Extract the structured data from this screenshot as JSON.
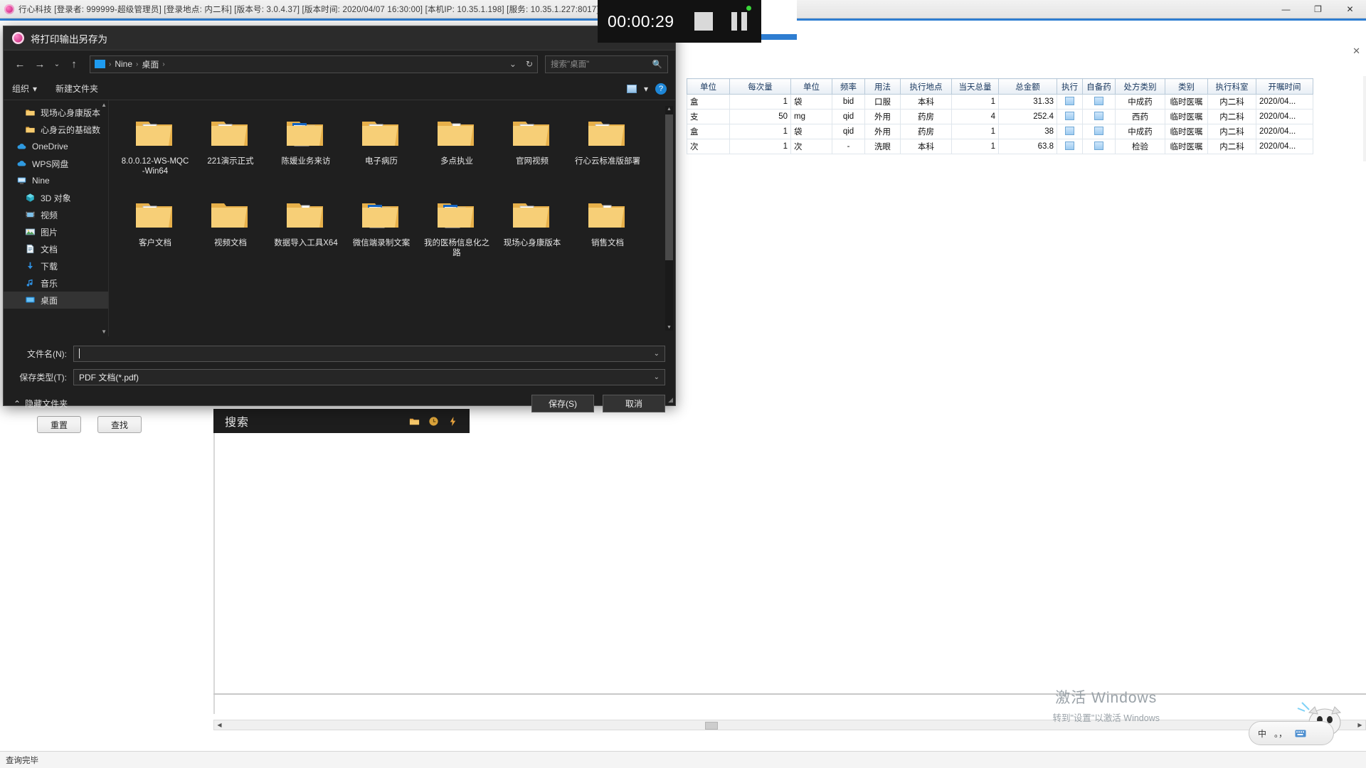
{
  "app": {
    "title": "行心科技   [登录者: 999999-超级管理员]   [登录地点: 内二科]   [版本号: 3.0.4.37]   [版本时间: 2020/04/07 16:30:00]   [本机IP: 10.35.1.198]   [服务: 10.35.1.227:8017]",
    "logo_icon": "app-logo-icon",
    "window_buttons": [
      {
        "name": "minimize",
        "glyph": "—"
      },
      {
        "name": "maximize",
        "glyph": "❐"
      },
      {
        "name": "close",
        "glyph": "✕"
      }
    ],
    "inner_close_glyph": "✕",
    "status_text": "查询完毕",
    "buttons": {
      "reset": "重置",
      "find": "查找"
    },
    "search_window": {
      "title": "搜索",
      "icons": [
        "folder-icon",
        "clock-icon",
        "lightning-icon"
      ]
    },
    "watermark": {
      "line1": "激活 Windows",
      "line2": "转到\"设置\"以激活 Windows"
    },
    "ime": {
      "mode": "中",
      "punctuation": "。，",
      "keyboard_icon": "keyboard-icon",
      "mascot_icon": "mascot-icon"
    }
  },
  "recorder": {
    "timer": "00:00:29",
    "stop_label": "stop-icon",
    "pause_label": "pause-icon",
    "status_dot_color": "#39d639"
  },
  "grid": {
    "columns": [
      "单位",
      "每次量",
      "单位",
      "频率",
      "用法",
      "执行地点",
      "当天总量",
      "总金额",
      "执行",
      "自备药",
      "处方类别",
      "类别",
      "执行科室",
      "开嘱时间"
    ],
    "rows": [
      {
        "unit1": "盒",
        "dose": "1",
        "unit2": "袋",
        "freq": "bid",
        "usage": "口服",
        "place": "本科",
        "day_total": "1",
        "amount": "31.33",
        "exec": "icon",
        "self": "icon",
        "rx_type": "中成药",
        "category": "临时医嘱",
        "dept": "内二科",
        "time": "2020/04..."
      },
      {
        "unit1": "支",
        "dose": "50",
        "unit2": "mg",
        "freq": "qid",
        "usage": "外用",
        "place": "药房",
        "day_total": "4",
        "amount": "252.4",
        "exec": "icon",
        "self": "icon",
        "rx_type": "西药",
        "category": "临时医嘱",
        "dept": "内二科",
        "time": "2020/04..."
      },
      {
        "unit1": "盒",
        "dose": "1",
        "unit2": "袋",
        "freq": "qid",
        "usage": "外用",
        "place": "药房",
        "day_total": "1",
        "amount": "38",
        "exec": "icon",
        "self": "icon",
        "rx_type": "中成药",
        "category": "临时医嘱",
        "dept": "内二科",
        "time": "2020/04..."
      },
      {
        "unit1": "次",
        "dose": "1",
        "unit2": "次",
        "freq": "-",
        "usage": "洗眼",
        "place": "本科",
        "day_total": "1",
        "amount": "63.8",
        "exec": "icon",
        "self": "icon",
        "rx_type": "检验",
        "category": "临时医嘱",
        "dept": "内二科",
        "time": "2020/04..."
      }
    ]
  },
  "dialog": {
    "title": "将打印输出另存为",
    "title_icon": "app-logo-icon",
    "nav": {
      "back_icon": "arrow-left-icon",
      "forward_icon": "arrow-right-icon",
      "recent_icon": "chevron-down-icon",
      "up_icon": "arrow-up-icon"
    },
    "address": {
      "folder_icon": "folder-icon",
      "crumbs": [
        "Nine",
        "桌面"
      ],
      "dropdown_icon": "chevron-down-icon",
      "refresh_icon": "refresh-icon"
    },
    "search": {
      "placeholder": "搜索\"桌面\"",
      "icon": "search-icon"
    },
    "toolbar": {
      "organize": "组织",
      "organize_caret": "▾",
      "new_folder": "新建文件夹",
      "view_icon": "view-icon",
      "view_caret": "▾",
      "help_icon": "help-icon",
      "help_glyph": "?"
    },
    "sidebar": [
      {
        "label": "现场心身康版本",
        "icon": "folder-icon",
        "indent": 1,
        "selected": false
      },
      {
        "label": "心身云的基础数",
        "icon": "folder-icon",
        "indent": 1,
        "selected": false
      },
      {
        "label": "OneDrive",
        "icon": "cloud-icon",
        "indent": 0,
        "selected": false
      },
      {
        "label": "WPS网盘",
        "icon": "cloud-icon",
        "indent": 0,
        "selected": false
      },
      {
        "label": "Nine",
        "icon": "computer-icon",
        "indent": 0,
        "selected": false
      },
      {
        "label": "3D 对象",
        "icon": "cube-icon",
        "indent": 1,
        "selected": false
      },
      {
        "label": "视频",
        "icon": "video-icon",
        "indent": 1,
        "selected": false
      },
      {
        "label": "图片",
        "icon": "picture-icon",
        "indent": 1,
        "selected": false
      },
      {
        "label": "文档",
        "icon": "document-icon",
        "indent": 1,
        "selected": false
      },
      {
        "label": "下载",
        "icon": "download-icon",
        "indent": 1,
        "selected": false
      },
      {
        "label": "音乐",
        "icon": "music-icon",
        "indent": 1,
        "selected": false
      },
      {
        "label": "桌面",
        "icon": "desktop-icon",
        "indent": 1,
        "selected": true
      }
    ],
    "files": [
      {
        "label": "8.0.0.12-WS-MQC-Win64",
        "icon": "folder-docs-icon"
      },
      {
        "label": "221演示正式",
        "icon": "folder-docs-icon"
      },
      {
        "label": "陈媛业务来访",
        "icon": "folder-blue-doc-icon"
      },
      {
        "label": "电子病历",
        "icon": "folder-docs-icon"
      },
      {
        "label": "多点执业",
        "icon": "folder-lined-icon"
      },
      {
        "label": "官网视频",
        "icon": "folder-docs-icon"
      },
      {
        "label": "行心云标准版部署",
        "icon": "folder-docs-icon"
      },
      {
        "label": "客户文档",
        "icon": "folder-docs-icon"
      },
      {
        "label": "视频文档",
        "icon": "folder-plain-icon"
      },
      {
        "label": "数据导入工具X64",
        "icon": "folder-lined-icon"
      },
      {
        "label": "微信端录制文案",
        "icon": "folder-blue-doc-icon"
      },
      {
        "label": "我的医杨信息化之路",
        "icon": "folder-blue-doc-icon"
      },
      {
        "label": "现场心身康版本",
        "icon": "folder-docs-icon"
      },
      {
        "label": "销售文档",
        "icon": "folder-lined-icon"
      }
    ],
    "fields": {
      "filename_label": "文件名(N):",
      "filename_value": "",
      "filetype_label": "保存类型(T):",
      "filetype_value": "PDF 文档(*.pdf)",
      "chevron": "⌄"
    },
    "hide_folders": {
      "label": "隐藏文件夹",
      "chevron": "⌃"
    },
    "buttons": {
      "save": "保存(S)",
      "cancel": "取消"
    }
  }
}
